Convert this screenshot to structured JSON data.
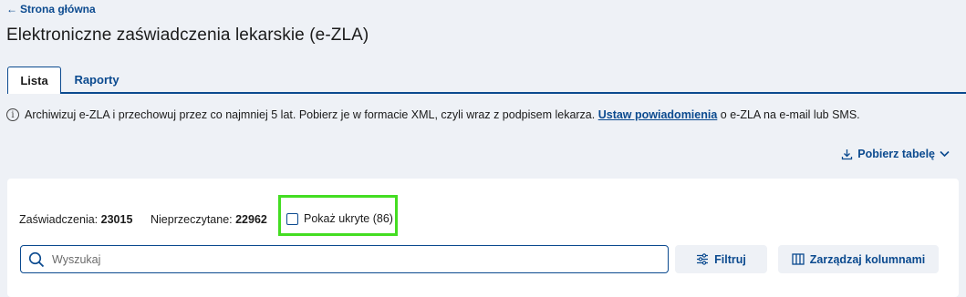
{
  "nav": {
    "back_label": "Strona główna"
  },
  "page": {
    "title": "Elektroniczne zaświadczenia lekarskie (e-ZLA)"
  },
  "tabs": [
    {
      "label": "Lista",
      "active": true
    },
    {
      "label": "Raporty",
      "active": false
    }
  ],
  "info": {
    "text_before": "Archiwizuj e-ZLA i przechowuj przez co najmniej 5 lat. Pobierz je w formacie XML, czyli wraz z podpisem lekarza.",
    "link_label": "Ustaw powiadomienia",
    "text_after": "o e-ZLA na e-mail lub SMS."
  },
  "toolbar": {
    "download_label": "Pobierz tabelę"
  },
  "stats": {
    "total_label": "Zaświadczenia:",
    "total_value": "23015",
    "unread_label": "Nieprzeczytane:",
    "unread_value": "22962"
  },
  "filters": {
    "show_hidden_label": "Pokaż ukryte (86)",
    "show_hidden_checked": false
  },
  "search": {
    "placeholder": "Wyszukaj",
    "value": ""
  },
  "actions": {
    "filter_label": "Filtruj",
    "columns_label": "Zarządzaj kolumnami"
  },
  "colors": {
    "primary": "#0b4a8f",
    "background": "#eef1f6",
    "highlight": "#44dd22"
  },
  "icons": [
    "arrow-left-icon",
    "info-icon",
    "download-icon",
    "chevron-down-icon",
    "search-icon",
    "filter-icon",
    "columns-icon"
  ]
}
